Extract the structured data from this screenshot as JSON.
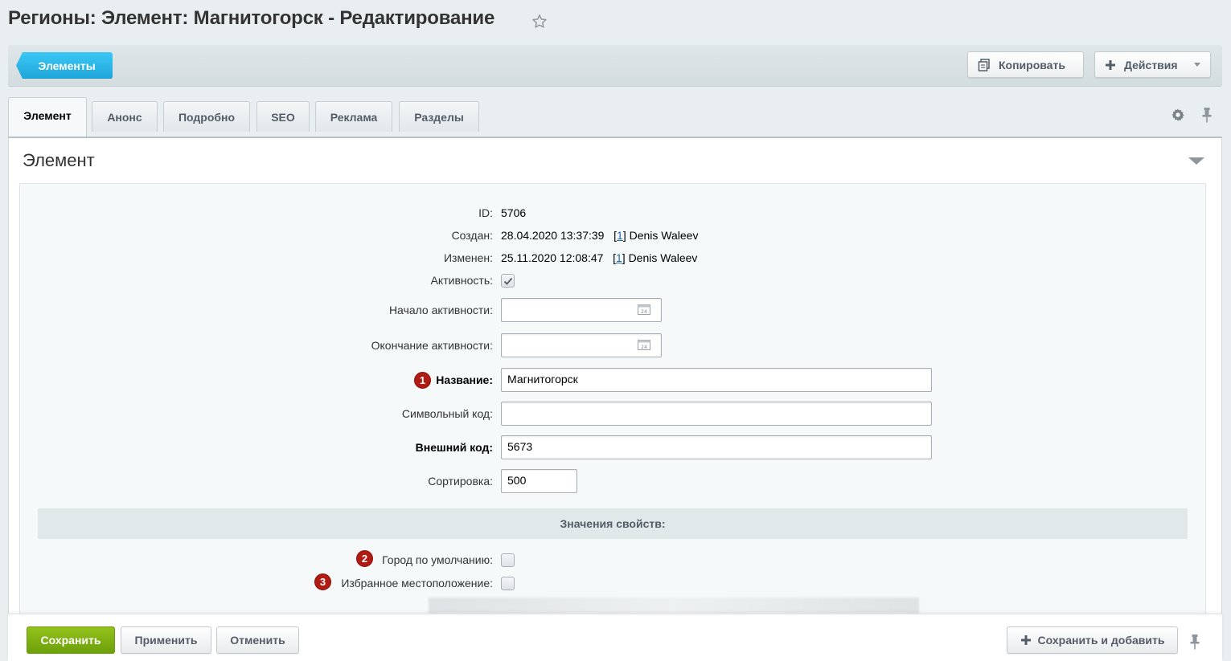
{
  "header": {
    "title": "Регионы: Элемент: Магнитогорск - Редактирование"
  },
  "toolbar": {
    "elements_label": "Элементы",
    "copy_label": "Копировать",
    "actions_label": "Действия"
  },
  "tabs": [
    {
      "label": "Элемент",
      "active": true
    },
    {
      "label": "Анонс"
    },
    {
      "label": "Подробно"
    },
    {
      "label": "SEO"
    },
    {
      "label": "Реклама"
    },
    {
      "label": "Разделы"
    }
  ],
  "section": {
    "title": "Элемент"
  },
  "form": {
    "id_label": "ID:",
    "id_value": "5706",
    "created_label": "Создан:",
    "created_date": "28.04.2020 13:37:39",
    "created_user_id": "1",
    "created_user_name": "Denis Waleev",
    "modified_label": "Изменен:",
    "modified_date": "25.11.2020 12:08:47",
    "modified_user_id": "1",
    "modified_user_name": "Denis Waleev",
    "active_label": "Активность:",
    "active_checked": true,
    "active_from_label": "Начало активности:",
    "active_from_value": "",
    "active_to_label": "Окончание активности:",
    "active_to_value": "",
    "name_label": "Название:",
    "name_value": "Магнитогорск",
    "code_label": "Символьный код:",
    "code_value": "",
    "xml_id_label": "Внешний код:",
    "xml_id_value": "5673",
    "sort_label": "Сортировка:",
    "sort_value": "500"
  },
  "properties": {
    "header": "Значения свойств:",
    "default_city_label": "Город по умолчанию:",
    "default_city_checked": false,
    "favorite_location_label": "Избранное местоположение:",
    "favorite_location_checked": false
  },
  "markers": [
    "1",
    "2",
    "3"
  ],
  "footer": {
    "save_label": "Сохранить",
    "apply_label": "Применить",
    "cancel_label": "Отменить",
    "save_add_label": "Сохранить и добавить"
  },
  "colors": {
    "accent_blue": "#1ea5d8",
    "save_green": "#7db414",
    "marker_red": "#b01b13",
    "link_blue": "#2067b0"
  }
}
